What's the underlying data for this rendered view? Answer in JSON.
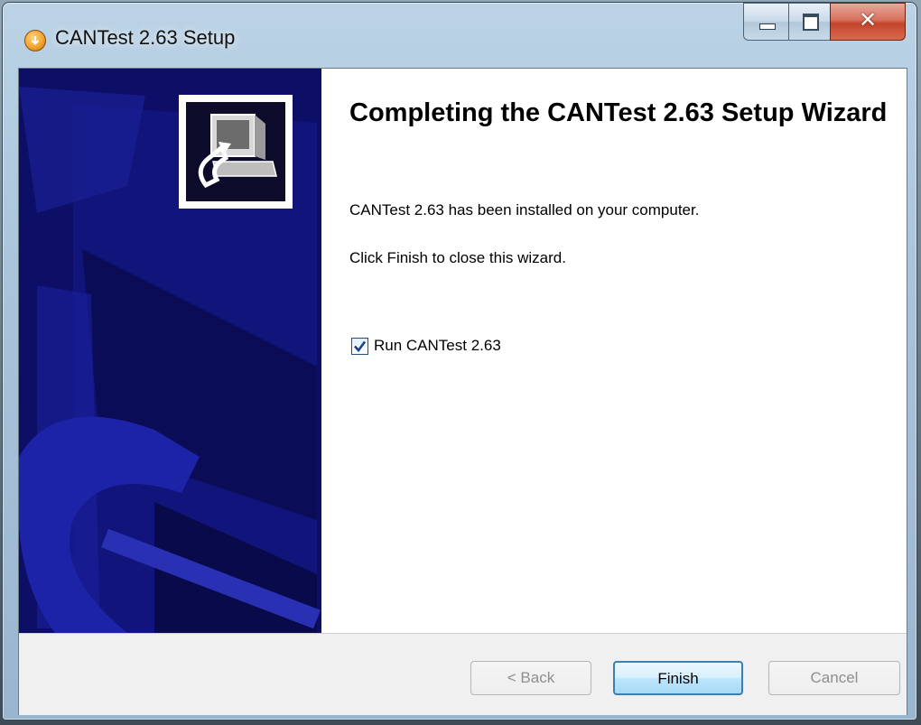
{
  "window": {
    "title": "CANTest 2.63 Setup"
  },
  "main": {
    "heading": "Completing the CANTest 2.63 Setup Wizard",
    "installed_text": "CANTest 2.63 has been installed on your computer.",
    "instruction_text": "Click Finish to close this wizard."
  },
  "options": {
    "run_checkbox_label": "Run CANTest 2.63",
    "run_checked": true
  },
  "buttons": {
    "back": "< Back",
    "finish": "Finish",
    "cancel": "Cancel"
  },
  "colors": {
    "sidebar": "#0d0f66",
    "finish_border": "#3c7fb1"
  }
}
